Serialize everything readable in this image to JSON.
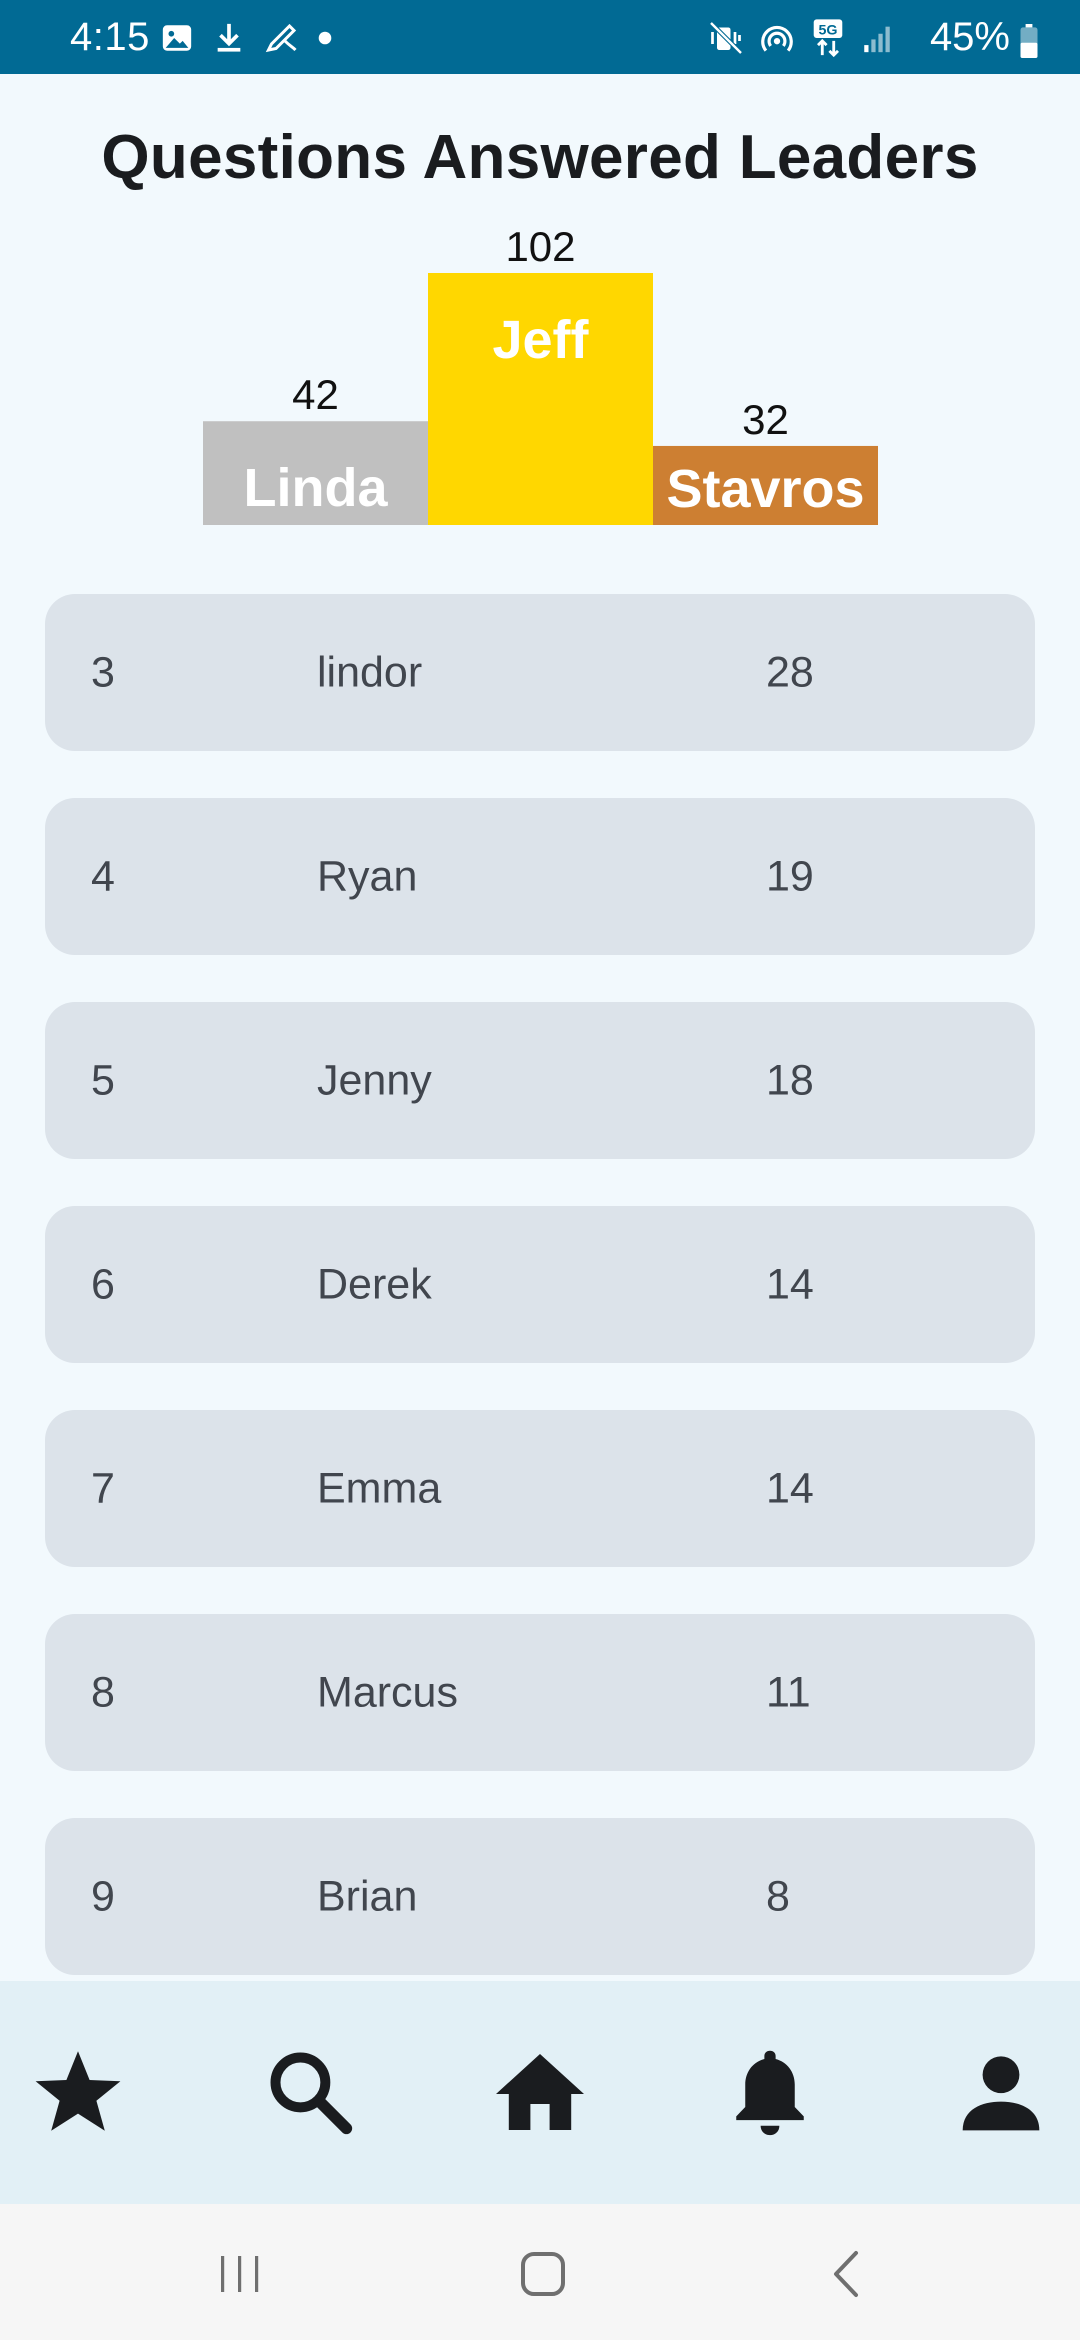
{
  "status_bar": {
    "time": "4:15",
    "battery": "45%",
    "background": "#016a94",
    "left_icons": [
      "image-icon",
      "download-icon",
      "stylus-icon",
      "dot-icon"
    ],
    "right_icons": [
      "mute-vibrate-icon",
      "hotspot-icon",
      "5g-icon",
      "signal-icon",
      "battery-icon"
    ]
  },
  "title": "Questions Answered Leaders",
  "chart_data": {
    "type": "bar",
    "categories": [
      "Linda",
      "Jeff",
      "Stavros"
    ],
    "values": [
      42,
      102,
      32
    ],
    "colors": [
      "#c0c0c0",
      "#ffd700",
      "#cd7f32"
    ],
    "title": "Questions Answered Leaders",
    "xlabel": "",
    "ylabel": "",
    "ylim": [
      0,
      102
    ],
    "grid": false
  },
  "leaders": [
    {
      "rank": "3",
      "name": "lindor",
      "score": "28"
    },
    {
      "rank": "4",
      "name": "Ryan",
      "score": "19"
    },
    {
      "rank": "5",
      "name": "Jenny",
      "score": "18"
    },
    {
      "rank": "6",
      "name": "Derek",
      "score": "14"
    },
    {
      "rank": "7",
      "name": "Emma",
      "score": "14"
    },
    {
      "rank": "8",
      "name": "Marcus",
      "score": "11"
    },
    {
      "rank": "9",
      "name": "Brian",
      "score": "8"
    }
  ],
  "bottom_nav": {
    "items": [
      "star-icon",
      "search-icon",
      "home-icon",
      "bell-icon",
      "profile-icon"
    ],
    "background": "#e2f0f6"
  },
  "system_nav": {
    "items": [
      "recents-icon",
      "home-outline-icon",
      "back-icon"
    ]
  }
}
